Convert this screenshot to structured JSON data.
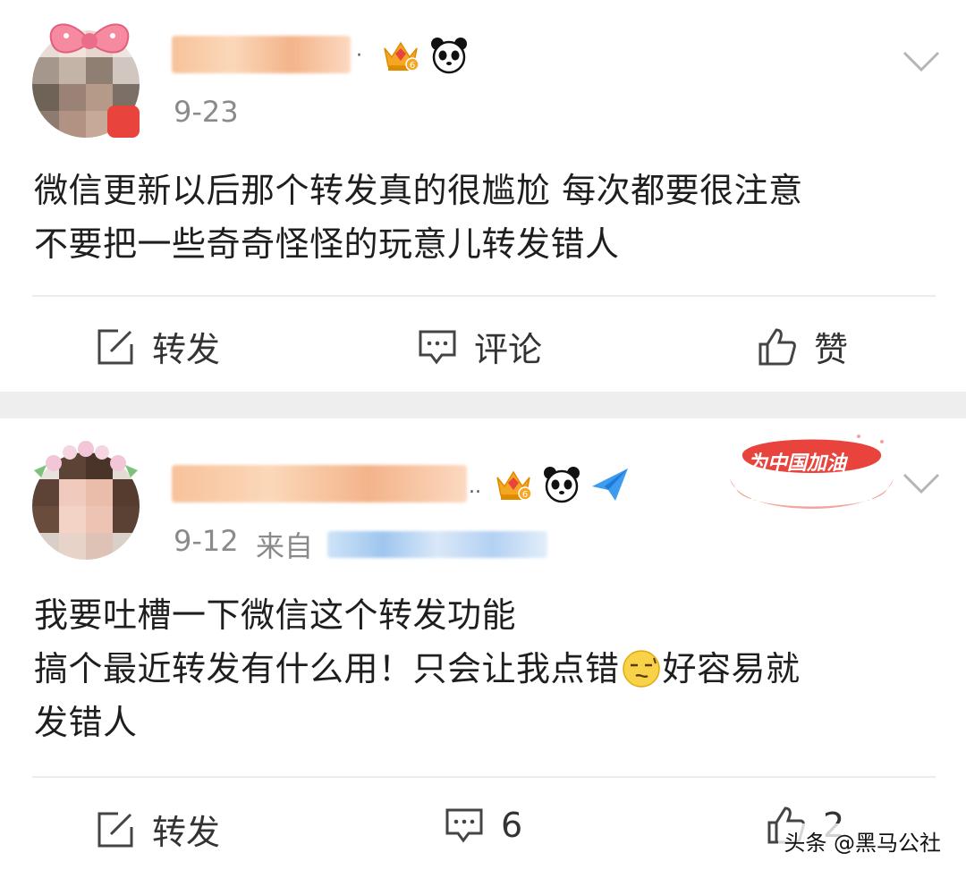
{
  "colors": {
    "page_background": "#ffffff",
    "separator_band": "#eeeeee",
    "meta_text": "#8a8a8a",
    "accent_red": "#e8433c",
    "gold": "#f5a623",
    "plane_blue": "#3d9bf0"
  },
  "posts": [
    {
      "avatar_icon": "blurred-avatar-with-bow",
      "badges": [
        "crown-level-6-icon",
        "panda-icon"
      ],
      "date": "9-23",
      "content_lines": [
        "微信更新以后那个转发真的很尴尬 每次都要很注意",
        "不要把一些奇奇怪怪的玩意儿转发错人"
      ],
      "actions": {
        "repost_label": "转发",
        "comment_label": "评论",
        "like_label": "赞"
      }
    },
    {
      "avatar_icon": "blurred-avatar-with-flowers",
      "name_suffix": "..",
      "badges": [
        "crown-level-6-icon",
        "panda-icon",
        "paper-plane-icon"
      ],
      "promo_text": "为中国加油",
      "date": "9-12",
      "source_prefix": "来自",
      "content_lines": [
        "我要吐槽一下微信这个转发功能",
        "搞个最近转发有什么用！只会让我点错",
        "好容易就",
        "发错人"
      ],
      "emoji_icon": "awkward-face-emoji-icon",
      "actions": {
        "repost_label": "转发",
        "comment_count": "6",
        "like_count": "2"
      }
    }
  ],
  "watermark": "头条 @黑马公社"
}
